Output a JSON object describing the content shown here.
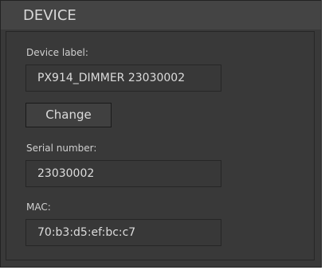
{
  "panel": {
    "title": "DEVICE"
  },
  "device": {
    "label_caption": "Device label:",
    "label_value": "PX914_DIMMER 23030002",
    "change_button": "Change",
    "serial_caption": "Serial number:",
    "serial_value": "23030002",
    "mac_caption": "MAC:",
    "mac_value": "70:b3:d5:ef:bc:c7"
  },
  "colors": {
    "panel_background": "#393939",
    "header_background": "#444444",
    "text": "#d8d8d8",
    "border": "#262626"
  }
}
